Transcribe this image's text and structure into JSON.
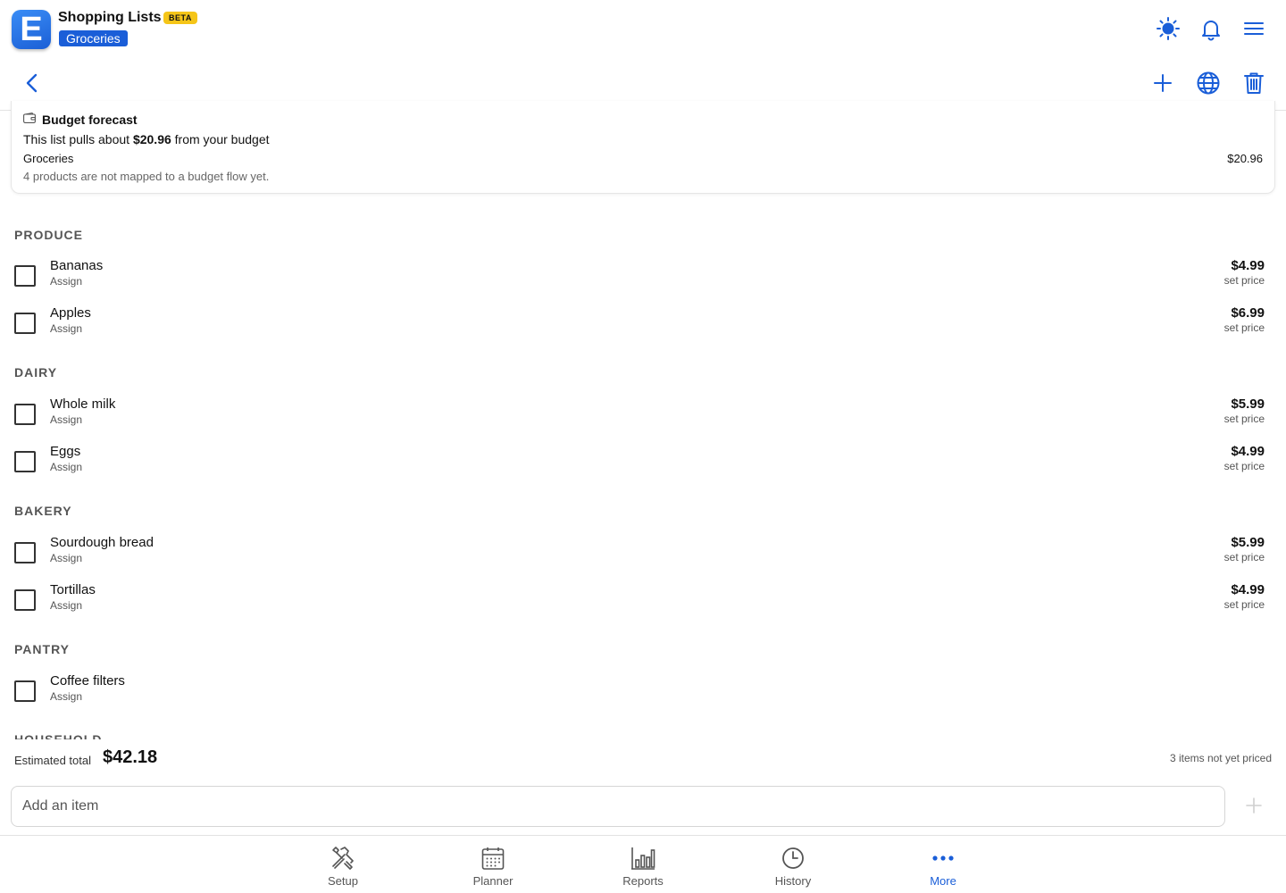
{
  "header": {
    "app_title": "Shopping Lists",
    "beta_label": "BETA",
    "list_name": "Groceries",
    "logo_letter": "E",
    "icons": [
      "sun-icon",
      "bell-icon",
      "hamburger-menu-icon"
    ]
  },
  "toolbar": {
    "icons": [
      "back-chevron-icon",
      "plus-icon",
      "globe-icon",
      "trash-icon"
    ]
  },
  "budget": {
    "title": "Budget forecast",
    "line_prefix": "This list pulls about ",
    "line_amount": "$20.96",
    "line_suffix": " from your budget",
    "category": "Groceries",
    "category_amount": "$20.96",
    "note": "4 products are not mapped to a budget flow yet."
  },
  "sections": [
    {
      "title": "PRODUCE",
      "items": [
        {
          "name": "Bananas",
          "sub": "Assign",
          "price": "$4.99",
          "price_sub": "set price"
        },
        {
          "name": "Apples",
          "sub": "Assign",
          "price": "$6.99",
          "price_sub": "set price"
        }
      ]
    },
    {
      "title": "DAIRY",
      "items": [
        {
          "name": "Whole milk",
          "sub": "Assign",
          "price": "$5.99",
          "price_sub": "set price"
        },
        {
          "name": "Eggs",
          "sub": "Assign",
          "price": "$4.99",
          "price_sub": "set price"
        }
      ]
    },
    {
      "title": "BAKERY",
      "items": [
        {
          "name": "Sourdough bread",
          "sub": "Assign",
          "price": "$5.99",
          "price_sub": "set price"
        },
        {
          "name": "Tortillas",
          "sub": "Assign",
          "price": "$4.99",
          "price_sub": "set price"
        }
      ]
    },
    {
      "title": "PANTRY",
      "items": [
        {
          "name": "Coffee filters",
          "sub": "Assign",
          "price": "",
          "price_sub": ""
        }
      ]
    },
    {
      "title": "HOUSEHOLD",
      "items": []
    }
  ],
  "totals": {
    "label": "Estimated total",
    "value": "$42.18",
    "unpriced": "3 items not yet priced"
  },
  "add_item": {
    "placeholder": "Add an item",
    "value": ""
  },
  "nav": {
    "items": [
      {
        "label": "Setup",
        "icon": "tools-icon"
      },
      {
        "label": "Planner",
        "icon": "calendar-icon"
      },
      {
        "label": "Reports",
        "icon": "bar-chart-icon"
      },
      {
        "label": "History",
        "icon": "clock-icon"
      },
      {
        "label": "More",
        "icon": "more-dots-icon"
      }
    ],
    "active": "More"
  },
  "colors": {
    "accent": "#1a5ed8",
    "beta": "#f5c518",
    "text": "#111111",
    "muted": "#555555"
  }
}
